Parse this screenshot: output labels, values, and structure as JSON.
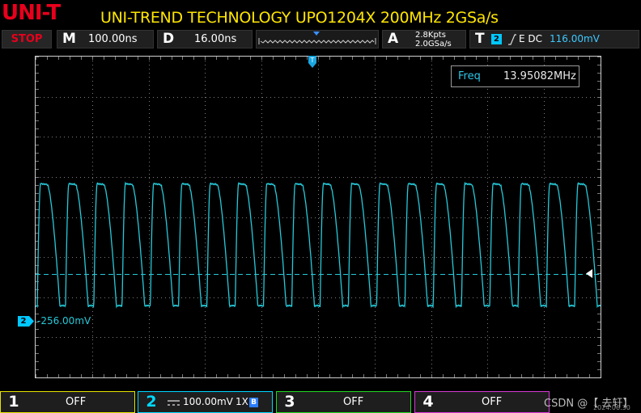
{
  "header": {
    "logo": "UNI-T",
    "title": "UNI-TREND TECHNOLOGY UPO1204X 200MHz 2GSa/s"
  },
  "status_bar": {
    "run_state": "STOP",
    "main_timebase_key": "M",
    "main_timebase": "100.00ns",
    "delay_key": "D",
    "delay": "16.00ns",
    "acquire_key": "A",
    "memory_depth": "2.8Kpts",
    "sample_rate": "2.0GSa/s",
    "trigger_key": "T",
    "trigger_source": "2",
    "trigger_slope_edge": "E DC",
    "trigger_level": "116.00mV"
  },
  "screen": {
    "trigger_marker": "T",
    "measurement_label": "Freq",
    "measurement_value": "13.95082MHz",
    "ch2_marker": "2",
    "ch2_offset": "-256.00mV",
    "waveform_color": "#26c9d9",
    "grid_color": "#7c7c7c"
  },
  "channels": [
    {
      "num": "1",
      "state": "OFF",
      "color": "#e6e600"
    },
    {
      "num": "2",
      "coupling_icon": "DC",
      "scale": "100.00mV",
      "probe": "1X",
      "bw_badge": "B",
      "color": "#00d8ff"
    },
    {
      "num": "3",
      "state": "OFF",
      "color": "#22d822"
    },
    {
      "num": "4",
      "state": "OFF",
      "color": "#d838d8"
    }
  ],
  "watermark": {
    "text": "CSDN @【 去轩】",
    "date": "2024.06.30"
  }
}
